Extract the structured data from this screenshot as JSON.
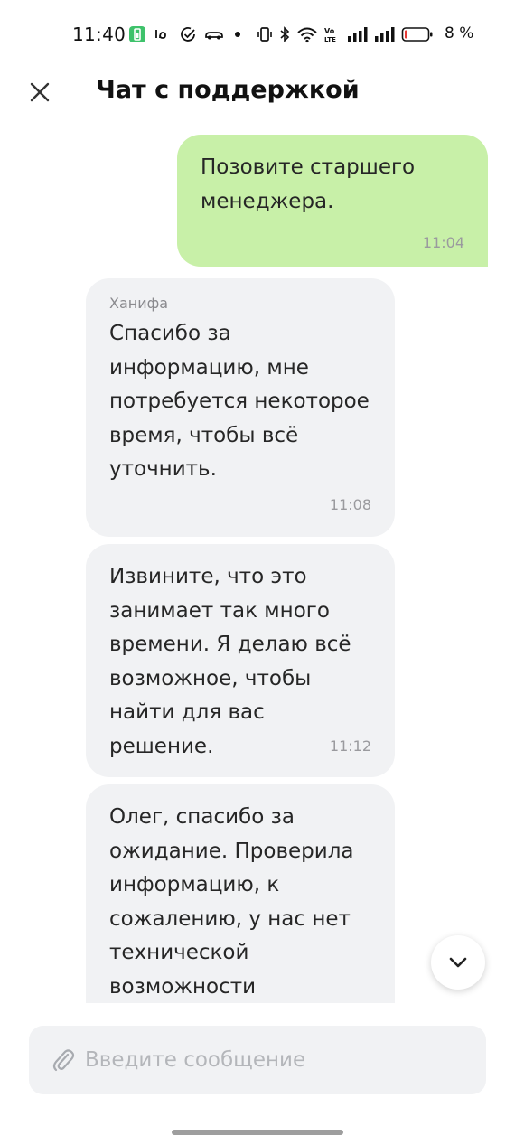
{
  "status_bar": {
    "time": "11:40",
    "battery_percent": "8 %"
  },
  "header": {
    "title": "Чат с поддержкой"
  },
  "messages": [
    {
      "direction": "outgoing",
      "text": "Позовите старшего\nменеджера.",
      "time": "11:04"
    },
    {
      "direction": "incoming",
      "sender": "Ханифа",
      "text": "Спасибо за\nинформацию, мне\nпотребуется некоторое\nвремя, чтобы всё\nуточнить.",
      "time": "11:08"
    },
    {
      "direction": "incoming",
      "text": "Извините, что это\nзанимает так много\nвремени. Я делаю всё\nвозможное, чтобы\nнайти для вас решение.",
      "time": "11:12"
    },
    {
      "direction": "incoming",
      "text": "Олег, спасибо за\nожидание. Проверила\nинформацию, к\nсожалению, у нас нет\nтехнической\nвозможности"
    }
  ],
  "composer": {
    "placeholder": "Введите сообщение",
    "value": ""
  },
  "icons": {
    "close": "close-icon",
    "scroll_down": "chevron-down-icon",
    "attach": "paperclip-icon"
  },
  "colors": {
    "outgoing_bubble": "#c8f0a8",
    "incoming_bubble": "#f1f2f4",
    "battery_low": "#e53935"
  }
}
